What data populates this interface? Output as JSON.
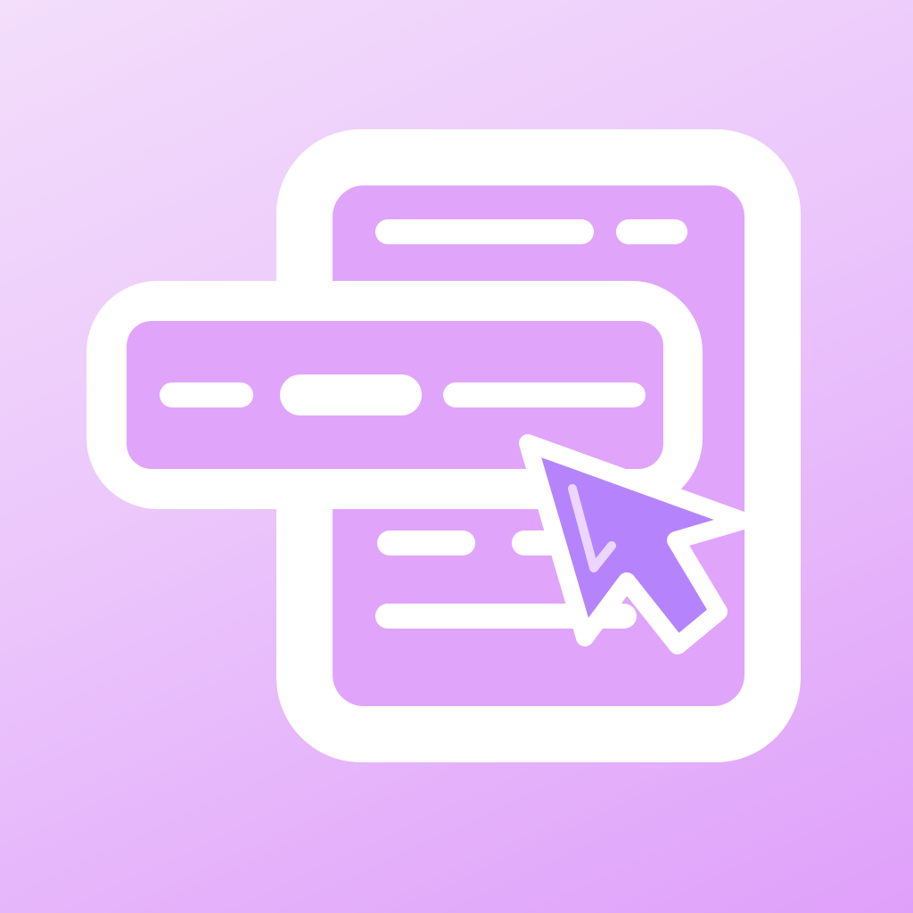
{
  "icon": {
    "name": "select-menu-cursor-icon",
    "colors": {
      "background_top": "#f3defb",
      "background_bottom": "#dfa0fa",
      "panel_fill": "#e0a5fb",
      "outline": "#ffffff",
      "cursor_fill": "#b584fd",
      "cursor_highlight": "#ecd6ff"
    }
  }
}
